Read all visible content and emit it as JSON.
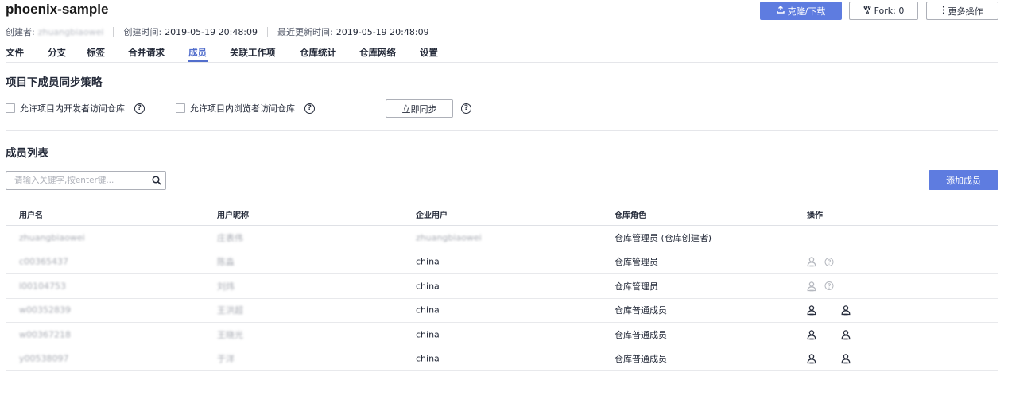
{
  "repo": {
    "name": "phoenix-sample",
    "creator_label": "创建者:",
    "creator_value": "zhuangbiaowei",
    "created_label": "创建时间:",
    "created_value": "2019-05-19 20:48:09",
    "updated_label": "最近更新时间:",
    "updated_value": "2019-05-19 20:48:09"
  },
  "top_actions": {
    "clone_label": "克隆/下载",
    "fork_label": "Fork: 0",
    "more_label": "更多操作"
  },
  "tabs": [
    {
      "label": "文件"
    },
    {
      "label": "分支"
    },
    {
      "label": "标签"
    },
    {
      "label": "合并请求"
    },
    {
      "label": "成员",
      "active": true
    },
    {
      "label": "关联工作项"
    },
    {
      "label": "仓库统计"
    },
    {
      "label": "仓库网络"
    },
    {
      "label": "设置"
    }
  ],
  "sync_policy": {
    "title": "项目下成员同步策略",
    "option_dev": "允许项目内开发者访问仓库",
    "option_viewer": "允许项目内浏览者访问仓库",
    "sync_button": "立即同步"
  },
  "member_list": {
    "title": "成员列表",
    "search_placeholder": "请输入关键字,按enter键...",
    "add_button": "添加成员",
    "columns": [
      "用户名",
      "用户昵称",
      "企业用户",
      "仓库角色",
      "操作"
    ],
    "rows": [
      {
        "username": "zhuangbiaowei",
        "nickname": "庄表伟",
        "enterprise": "zhuangbiaowei",
        "role": "仓库管理员 (仓库创建者)",
        "ops": "none"
      },
      {
        "username": "c00365437",
        "nickname": "陈淼",
        "enterprise": "china",
        "role": "仓库管理员",
        "ops": "dim"
      },
      {
        "username": "l00104753",
        "nickname": "刘炜",
        "enterprise": "china",
        "role": "仓库管理员",
        "ops": "dim"
      },
      {
        "username": "w00352839",
        "nickname": "王洪超",
        "enterprise": "china",
        "role": "仓库普通成员",
        "ops": "active"
      },
      {
        "username": "w00367218",
        "nickname": "王晓光",
        "enterprise": "china",
        "role": "仓库普通成员",
        "ops": "active"
      },
      {
        "username": "y00538097",
        "nickname": "于洋",
        "enterprise": "china",
        "role": "仓库普通成员",
        "ops": "active"
      }
    ]
  },
  "colors": {
    "primary": "#5e7ce0",
    "tab_active": "#526ecc",
    "text": "#252b3a",
    "muted": "#adb0b8"
  },
  "icons": {
    "clone": "upload-icon",
    "fork": "fork-icon",
    "more": "more-vertical-icon",
    "search": "search-icon",
    "help": "help-circle-icon",
    "user_admin": "user-admin-icon",
    "user_remove": "user-remove-icon"
  }
}
